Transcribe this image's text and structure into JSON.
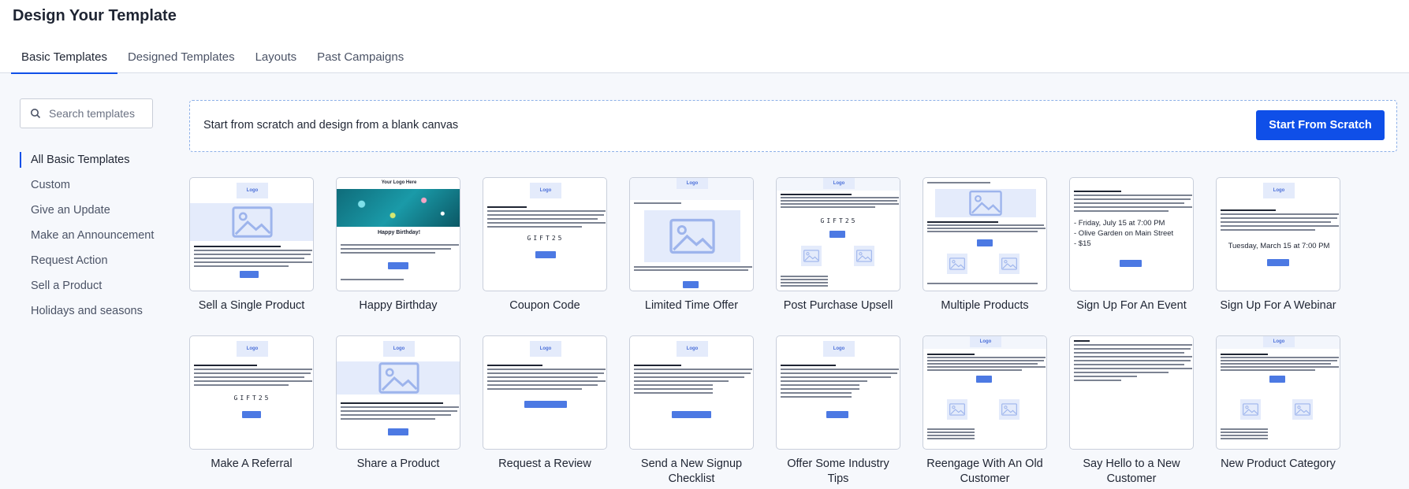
{
  "page_title": "Design Your Template",
  "tabs": [
    {
      "label": "Basic Templates",
      "active": true
    },
    {
      "label": "Designed Templates",
      "active": false
    },
    {
      "label": "Layouts",
      "active": false
    },
    {
      "label": "Past Campaigns",
      "active": false
    }
  ],
  "search": {
    "placeholder": "Search templates",
    "icon": "search-icon"
  },
  "categories": [
    {
      "label": "All Basic Templates",
      "active": true
    },
    {
      "label": "Custom"
    },
    {
      "label": "Give an Update"
    },
    {
      "label": "Make an Announcement"
    },
    {
      "label": "Request Action"
    },
    {
      "label": "Sell a Product"
    },
    {
      "label": "Holidays and seasons"
    }
  ],
  "scratch": {
    "text": "Start from scratch and design from a blank canvas",
    "button_label": "Start From Scratch"
  },
  "templates": [
    {
      "label": "Sell a Single Product",
      "thumb": "hero",
      "logo": "Logo"
    },
    {
      "label": "Happy Birthday",
      "thumb": "birthday",
      "header": "Your Logo Here",
      "heading": "Happy Birthday!"
    },
    {
      "label": "Coupon Code",
      "thumb": "coupon",
      "logo": "Logo",
      "code": "GIFT25"
    },
    {
      "label": "Limited Time Offer",
      "thumb": "limited",
      "logo": "Logo"
    },
    {
      "label": "Post Purchase Upsell",
      "thumb": "upsell",
      "logo": "Logo",
      "code": "GIFT25"
    },
    {
      "label": "Multiple Products",
      "thumb": "multi"
    },
    {
      "label": "Sign Up For An Event",
      "thumb": "event",
      "event_lines": [
        "- Friday, July 15 at 7:00 PM",
        "- Olive Garden on Main Street",
        "- $15"
      ]
    },
    {
      "label": "Sign Up For A Webinar",
      "thumb": "webinar",
      "logo": "Logo",
      "date_line": "Tuesday, March 15 at 7:00 PM"
    },
    {
      "label": "Make A Referral",
      "thumb": "referral",
      "logo": "Logo",
      "code": "GIFT25"
    },
    {
      "label": "Share a Product",
      "thumb": "share",
      "logo": "Logo"
    },
    {
      "label": "Request a Review",
      "thumb": "review",
      "logo": "Logo"
    },
    {
      "label": "Send a New Signup Checklist",
      "thumb": "checklist",
      "logo": "Logo"
    },
    {
      "label": "Offer Some Industry Tips",
      "thumb": "tips",
      "logo": "Logo"
    },
    {
      "label": "Reengage With An Old Customer",
      "thumb": "reengage",
      "logo": "Logo"
    },
    {
      "label": "Say Hello to a New Customer",
      "thumb": "hello"
    },
    {
      "label": "New Product Category",
      "thumb": "category",
      "logo": "Logo"
    }
  ],
  "colors": {
    "accent": "#0f4fe8",
    "thumb_placeholder": "#e4ebfb",
    "thumb_button": "#4c79e3"
  }
}
